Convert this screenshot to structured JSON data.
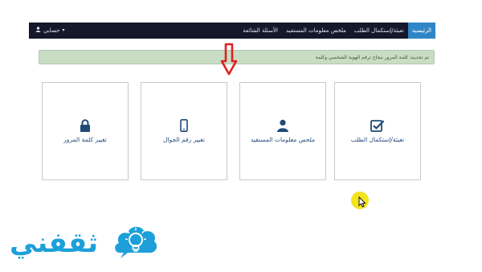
{
  "navbar": {
    "items": [
      {
        "label": "الرئيسية",
        "active": true
      },
      {
        "label": "تعبئة/إستكمال الطلب",
        "active": false
      },
      {
        "label": "ملخص معلومات المستفيد",
        "active": false
      },
      {
        "label": "الأسئلة الشائعة",
        "active": false
      }
    ],
    "account_label": "حسابي",
    "account_icon": "user-icon"
  },
  "alert": {
    "text": "تم تحديث كلمة المرور بنجاح ترقم الهوية الشخصي وكلمة",
    "color": "#c8ddc4"
  },
  "cards": [
    {
      "label": "تغيير كلمة المرور",
      "icon": "lock-icon"
    },
    {
      "label": "تغيير رقم الجوال",
      "icon": "mobile-icon"
    },
    {
      "label": "ملخص معلومات المستفيد",
      "icon": "user-icon"
    },
    {
      "label": "تعبئة/إستكمال الطلب",
      "icon": "checkbox-icon"
    }
  ],
  "logo": {
    "text": "ثقفني",
    "icon": "lightbulb-icon",
    "color": "#1da0d9"
  },
  "colors": {
    "navbar": "#14182a",
    "nav_active": "#2f86c7",
    "card_label": "#1f4a78",
    "arrow": "#e02020",
    "cursor_highlight": "#f4e21e"
  }
}
